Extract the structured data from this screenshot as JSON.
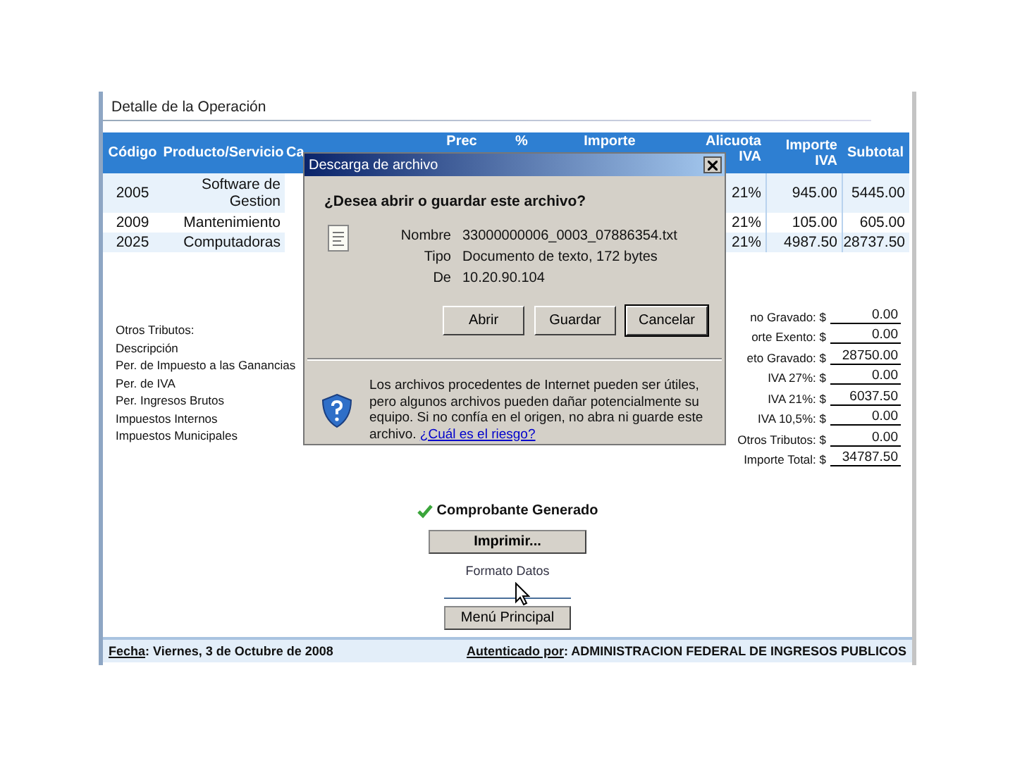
{
  "page_title": "Detalle de la Operación",
  "table": {
    "columns": [
      "Código",
      "Producto/Servicio",
      "Ca",
      "Prec",
      "%",
      "Importe",
      "Alicuota IVA",
      "Importe IVA",
      "Subtotal"
    ],
    "rows": [
      {
        "codigo": "2005",
        "producto": "Software de Gestion",
        "alicuota": "21%",
        "importe_iva": "945.00",
        "subtotal": "5445.00"
      },
      {
        "codigo": "2009",
        "producto": "Mantenimiento",
        "alicuota": "21%",
        "importe_iva": "105.00",
        "subtotal": "605.00"
      },
      {
        "codigo": "2025",
        "producto": "Computadoras",
        "alicuota": "21%",
        "importe_iva": "4987.50",
        "subtotal": "28737.50"
      }
    ]
  },
  "otros_tributos": [
    "Otros Tributos:",
    "Descripción",
    "Per. de Impuesto a las Ganancias",
    "Per. de IVA",
    "Per. Ingresos Brutos",
    "Impuestos Internos",
    "Impuestos Municipales"
  ],
  "totals": [
    {
      "label": "no Gravado: $",
      "value": "0.00"
    },
    {
      "label": "orte Exento: $",
      "value": "0.00"
    },
    {
      "label": "eto Gravado: $",
      "value": "28750.00"
    },
    {
      "label": "IVA 27%: $",
      "value": "0.00"
    },
    {
      "label": "IVA 21%: $",
      "value": "6037.50"
    },
    {
      "label": "IVA 10,5%: $",
      "value": "0.00"
    },
    {
      "label": "Otros Tributos: $",
      "value": "0.00"
    },
    {
      "label": "Importe Total: $",
      "value": "34787.50"
    }
  ],
  "status": "Comprobante Generado",
  "print_button": "Imprimir...",
  "link": "Formato Datos",
  "menu_button": "Menú Principal",
  "footer": {
    "date_label": "Fecha",
    "date": ": Viernes, 3 de Octubre de 2008",
    "auth_label": "Autenticado por",
    "auth": ": ADMINISTRACION FEDERAL DE INGRESOS PUBLICOS"
  },
  "dialog": {
    "title": "Descarga de archivo",
    "question": "¿Desea abrir o guardar este archivo?",
    "fields": [
      {
        "label": "Nombre",
        "value": "33000000006_0003_07886354.txt"
      },
      {
        "label": "Tipo",
        "value": "Documento de texto, 172 bytes"
      },
      {
        "label": "De",
        "value": "10.20.90.104"
      }
    ],
    "buttons": [
      {
        "label": "Abrir",
        "selected": false
      },
      {
        "label": "Guardar",
        "selected": false
      },
      {
        "label": "Cancelar",
        "selected": true
      }
    ],
    "warning": "Los archivos procedentes de Internet pueden ser útiles, pero algunos archivos pueden dañar potencialmente su equipo. Si no confía en el origen, no abra ni guarde este archivo. ",
    "warning_link": "¿Cuál es el riesgo?"
  }
}
